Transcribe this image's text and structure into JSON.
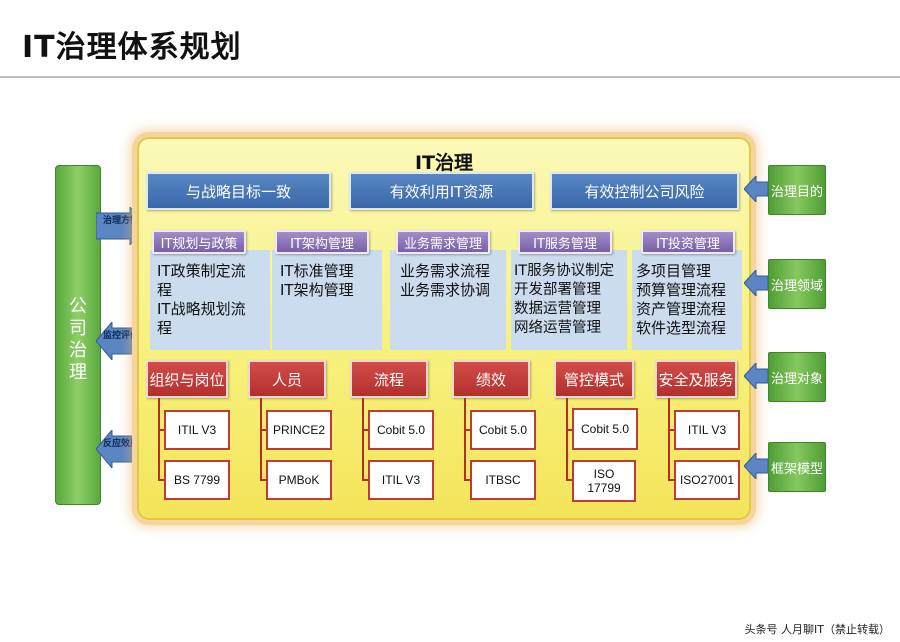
{
  "title": "IT治理体系规划",
  "corp": "公司治理",
  "arrows": [
    "治理方针",
    "监控评价",
    "反应效果"
  ],
  "panel_title": "IT治理",
  "goals": [
    "与战略目标一致",
    "有效利用IT资源",
    "有效控制公司风险"
  ],
  "columns": [
    {
      "header": "IT规划与政策",
      "lines": [
        "IT政策制定流",
        "程",
        "IT战略规划流",
        "程"
      ]
    },
    {
      "header": "IT架构管理",
      "lines": [
        "IT标准管理",
        "IT架构管理"
      ]
    },
    {
      "header": "业务需求管理",
      "lines": [
        "业务需求流程",
        "业务需求协调"
      ]
    },
    {
      "header": "IT服务管理",
      "lines": [
        "IT服务协议制定",
        "开发部署管理",
        "数据运营管理",
        "网络运营管理"
      ]
    },
    {
      "header": "IT投资管理",
      "lines": [
        "多项目管理",
        "预算管理流程",
        "资产管理流程",
        "软件选型流程"
      ]
    }
  ],
  "categories": [
    {
      "label": "组织与岗位",
      "items": [
        "ITIL V3",
        "BS 7799"
      ]
    },
    {
      "label": "人员",
      "items": [
        "PRINCE2",
        "PMBoK"
      ]
    },
    {
      "label": "流程",
      "items": [
        "Cobit 5.0",
        "ITIL V3"
      ]
    },
    {
      "label": "绩效",
      "items": [
        "Cobit 5.0",
        "ITBSC"
      ]
    },
    {
      "label": "管控模式",
      "items": [
        "Cobit 5.0",
        "ISO 17799"
      ]
    },
    {
      "label": "安全及服务",
      "items": [
        "ITIL V3",
        "ISO27001"
      ]
    }
  ],
  "side_labels": [
    "治理目的",
    "治理领域",
    "治理对象",
    "框架模型"
  ],
  "footer": "头条号 人月聊IT（禁止转载）",
  "colors": {
    "goal": "#3a67a8",
    "header": "#7a5fa9",
    "category": "#b2302c",
    "green": "#5aa83e",
    "panel": "#f7f07a"
  }
}
